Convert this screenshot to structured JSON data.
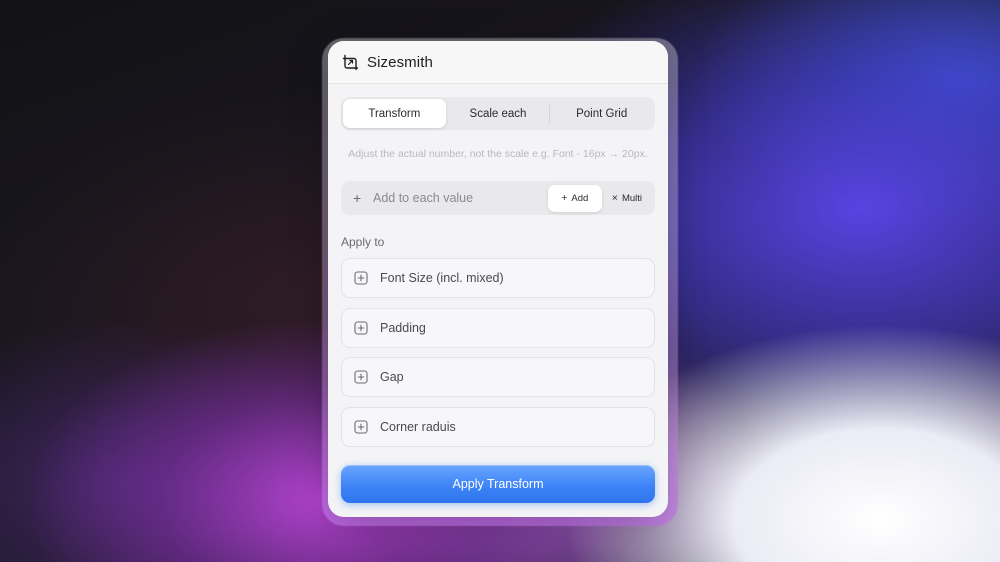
{
  "app": {
    "title": "Sizesmith",
    "logo_icon": "crop-scale-icon"
  },
  "tabs": [
    {
      "label": "Transform",
      "active": true
    },
    {
      "label": "Scale each",
      "active": false
    },
    {
      "label": "Point Grid",
      "active": false
    }
  ],
  "hint": "Adjust the actual number, not the scale e.g. Font - 16px → 20px.",
  "value_input": {
    "prefix": "+",
    "placeholder": "Add to each value",
    "value": ""
  },
  "modes": {
    "add_symbol": "+",
    "add_label": "Add",
    "multi_symbol": "×",
    "multi_label": "Multi",
    "active": "Add"
  },
  "apply_to": {
    "label": "Apply to",
    "options": [
      {
        "label": "Font Size (incl. mixed)",
        "icon": "plus-square-icon"
      },
      {
        "label": "Padding",
        "icon": "plus-square-icon"
      },
      {
        "label": "Gap",
        "icon": "plus-square-icon"
      },
      {
        "label": "Corner raduis",
        "icon": "plus-square-icon"
      }
    ]
  },
  "apply_button": {
    "label": "Apply Transform"
  },
  "colors": {
    "accent": "#3b82f6",
    "panel": "#f4f4f6"
  }
}
